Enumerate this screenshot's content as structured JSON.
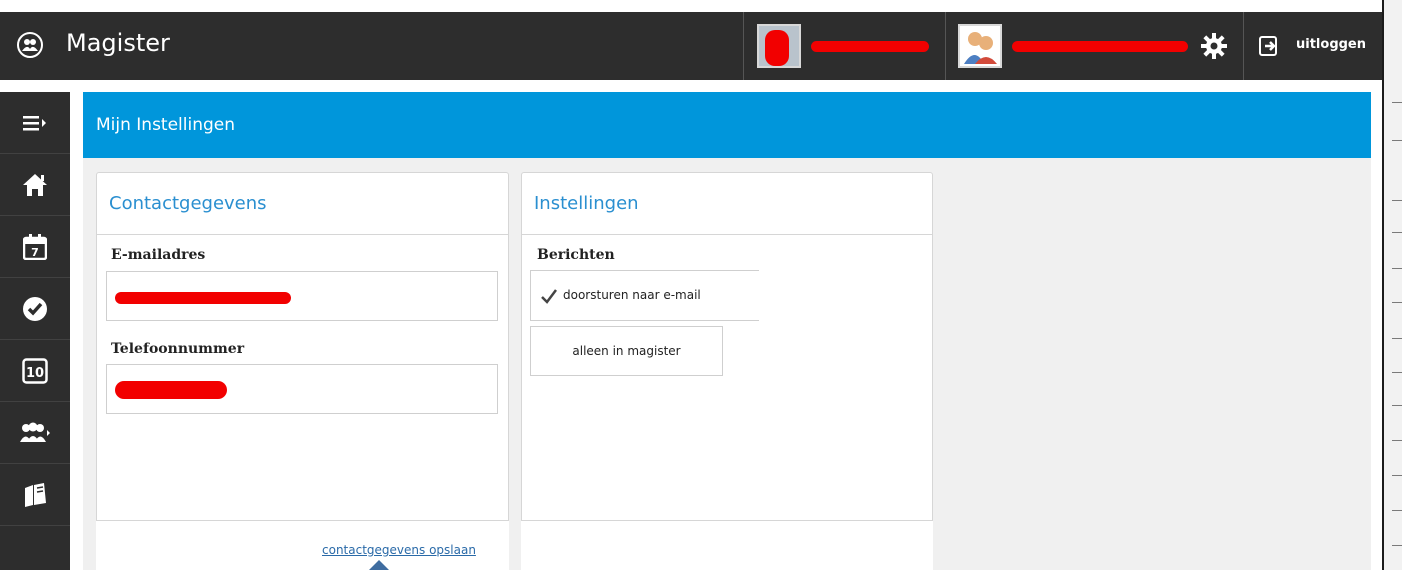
{
  "app": {
    "title": "Magister"
  },
  "topbar": {
    "users": [
      {
        "name": "",
        "redacted": true
      },
      {
        "name": "",
        "redacted": true
      }
    ],
    "settings_icon": "gear-icon",
    "logout_label": "uitloggen"
  },
  "sidebar": {
    "items": [
      {
        "icon": "menu-toggle-icon"
      },
      {
        "icon": "home-icon"
      },
      {
        "icon": "calendar-icon",
        "badge": "7"
      },
      {
        "icon": "check-icon"
      },
      {
        "icon": "grades-icon",
        "badge": "10"
      },
      {
        "icon": "people-icon"
      },
      {
        "icon": "books-icon"
      }
    ]
  },
  "page": {
    "title": "Mijn Instellingen"
  },
  "contact": {
    "title": "Contactgegevens",
    "email_label": "E-mailadres",
    "email_value": "",
    "phone_label": "Telefoonnummer",
    "phone_value": "",
    "save_link": "contactgegevens opslaan"
  },
  "settings": {
    "title": "Instellingen",
    "section_label": "Berichten",
    "options": [
      {
        "label": "doorsturen naar e-mail",
        "selected": true
      },
      {
        "label": "alleen in magister",
        "selected": false
      }
    ]
  },
  "colors": {
    "topbar": "#2d2d2d",
    "header": "#0096db",
    "accent_text": "#2a8fd0",
    "link": "#2a6aa8",
    "redaction": "#f20000"
  }
}
